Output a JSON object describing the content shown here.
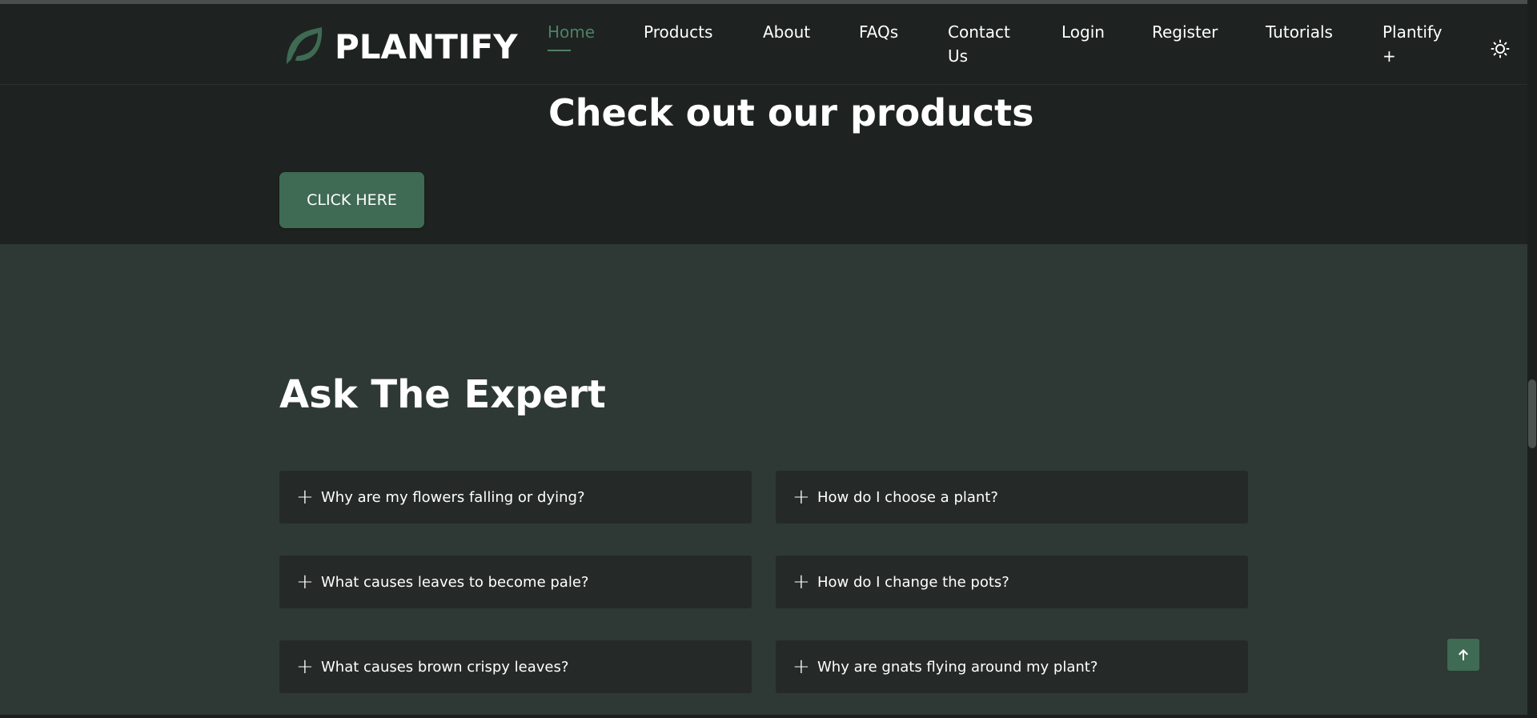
{
  "brand": {
    "name": "PLANTIFY",
    "logo_icon": "leaf-icon",
    "accent": "#3f6a54"
  },
  "nav": {
    "items": [
      {
        "label": "Home",
        "active": true
      },
      {
        "label": "Products"
      },
      {
        "label": "About"
      },
      {
        "label": "FAQs"
      },
      {
        "label": "Contact Us"
      },
      {
        "label": "Login"
      },
      {
        "label": "Register"
      },
      {
        "label": "Tutorials"
      },
      {
        "label": "Plantify +"
      }
    ],
    "theme_toggle_icon": "sun-icon"
  },
  "products_section": {
    "title": "Check out our products",
    "button_label": "CLICK HERE"
  },
  "expert_section": {
    "title": "Ask The Expert",
    "expand_symbol": "+",
    "faqs": [
      "Why are my flowers falling or dying?",
      "How do I choose a plant?",
      "What causes leaves to become pale?",
      "How do I change the pots?",
      "What causes brown crispy leaves?",
      "Why are gnats flying around my plant?"
    ]
  },
  "scroll_top_icon": "arrow-up-icon"
}
